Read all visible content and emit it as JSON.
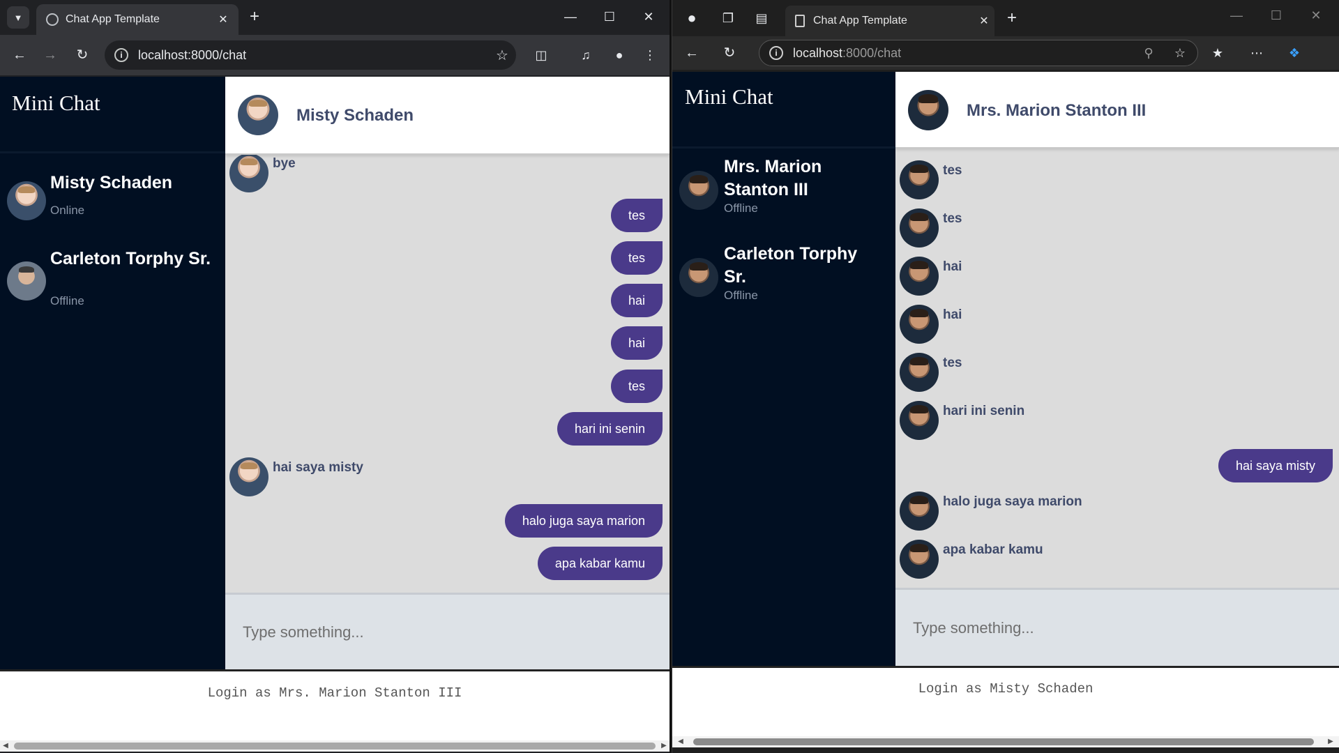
{
  "left": {
    "tab_title": "Chat App Template",
    "url": "localhost:8000/chat",
    "brand": "Mini Chat",
    "contacts": [
      {
        "name": "Misty Schaden",
        "status": "Online"
      },
      {
        "name": "Carleton Torphy Sr.",
        "status": "Offline"
      }
    ],
    "header_name": "Misty Schaden",
    "messages": [
      {
        "dir": "in",
        "text": "bye"
      },
      {
        "dir": "out",
        "text": "tes"
      },
      {
        "dir": "out",
        "text": "tes"
      },
      {
        "dir": "out",
        "text": "hai"
      },
      {
        "dir": "out",
        "text": "hai"
      },
      {
        "dir": "out",
        "text": "tes"
      },
      {
        "dir": "out",
        "text": "hari ini senin"
      },
      {
        "dir": "in",
        "text": "hai saya misty"
      },
      {
        "dir": "out",
        "text": "halo juga saya marion"
      },
      {
        "dir": "out",
        "text": "apa kabar kamu"
      }
    ],
    "input_placeholder": "Type something...",
    "login_text": "Login as Mrs. Marion Stanton III"
  },
  "right": {
    "tab_title": "Chat App Template",
    "url_host": "localhost",
    "url_rest": ":8000/chat",
    "brand": "Mini Chat",
    "contacts": [
      {
        "name_line1": "Mrs. Marion",
        "name_line2": "Stanton III",
        "status": "Offline"
      },
      {
        "name_line1": "Carleton Torphy",
        "name_line2": "Sr.",
        "status": "Offline"
      }
    ],
    "header_name": "Mrs. Marion Stanton III",
    "messages": [
      {
        "dir": "in",
        "text": "tes"
      },
      {
        "dir": "in",
        "text": "tes"
      },
      {
        "dir": "in",
        "text": "hai"
      },
      {
        "dir": "in",
        "text": "hai"
      },
      {
        "dir": "in",
        "text": "tes"
      },
      {
        "dir": "in",
        "text": "hari ini senin"
      },
      {
        "dir": "out",
        "text": "hai saya misty"
      },
      {
        "dir": "in",
        "text": "halo juga saya marion"
      },
      {
        "dir": "in",
        "text": "apa kabar kamu"
      }
    ],
    "input_placeholder": "Type something...",
    "login_text": "Login as Misty Schaden"
  },
  "colors": {
    "sidebar": "#010f22",
    "bubble": "#4a3a8a",
    "chat_bg": "#dcdcdc",
    "name_text": "#3f4a6a"
  }
}
